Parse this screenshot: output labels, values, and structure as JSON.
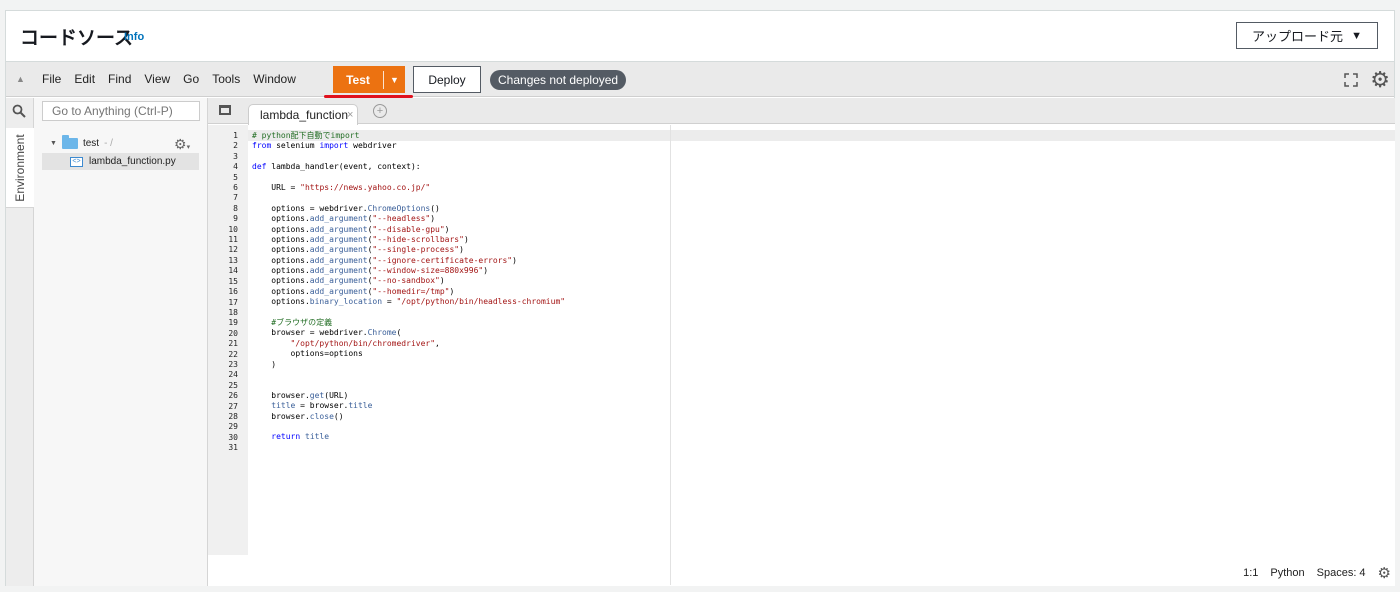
{
  "header": {
    "title": "コードソース",
    "info_link": "Info",
    "upload_button": "アップロード元",
    "upload_caret": "▼"
  },
  "toolbar": {
    "menu": [
      "File",
      "Edit",
      "Find",
      "View",
      "Go",
      "Tools",
      "Window"
    ],
    "test_label": "Test",
    "deploy_label": "Deploy",
    "status_badge": "Changes not deployed"
  },
  "sidebar": {
    "environment_tab": "Environment",
    "goto_placeholder": "Go to Anything (Ctrl-P)",
    "root_folder": "test",
    "root_suffix": "- /",
    "file_name": "lambda_function.py"
  },
  "editor": {
    "tab_label": "lambda_function",
    "tab_close": "×",
    "add_tab": "+",
    "line_numbers": [
      "1",
      "2",
      "3",
      "4",
      "5",
      "6",
      "7",
      "8",
      "9",
      "10",
      "11",
      "12",
      "13",
      "14",
      "15",
      "16",
      "17",
      "18",
      "19",
      "20",
      "21",
      "22",
      "23",
      "24",
      "25",
      "26",
      "27",
      "28",
      "29",
      "30",
      "31"
    ],
    "code_lines": [
      "# python配下自動でimport",
      "from selenium import webdriver",
      "",
      "def lambda_handler(event, context):",
      "",
      "    URL = \"https://news.yahoo.co.jp/\"",
      "",
      "    options = webdriver.ChromeOptions()",
      "    options.add_argument(\"--headless\")",
      "    options.add_argument(\"--disable-gpu\")",
      "    options.add_argument(\"--hide-scrollbars\")",
      "    options.add_argument(\"--single-process\")",
      "    options.add_argument(\"--ignore-certificate-errors\")",
      "    options.add_argument(\"--window-size=880x996\")",
      "    options.add_argument(\"--no-sandbox\")",
      "    options.add_argument(\"--homedir=/tmp\")",
      "    options.binary_location = \"/opt/python/bin/headless-chromium\"",
      "",
      "    #ブラウザの定義",
      "    browser = webdriver.Chrome(",
      "        \"/opt/python/bin/chromedriver\",",
      "        options=options",
      "    )",
      "",
      "",
      "    browser.get(URL)",
      "    title = browser.title",
      "    browser.close()",
      "",
      "    return title",
      ""
    ]
  },
  "statusbar": {
    "cursor": "1:1",
    "language": "Python",
    "spaces": "Spaces: 4"
  },
  "colors": {
    "accent": "#ec7211",
    "badge": "#545b64",
    "link": "#0073bb",
    "highlight_underline": "#e0111d"
  }
}
